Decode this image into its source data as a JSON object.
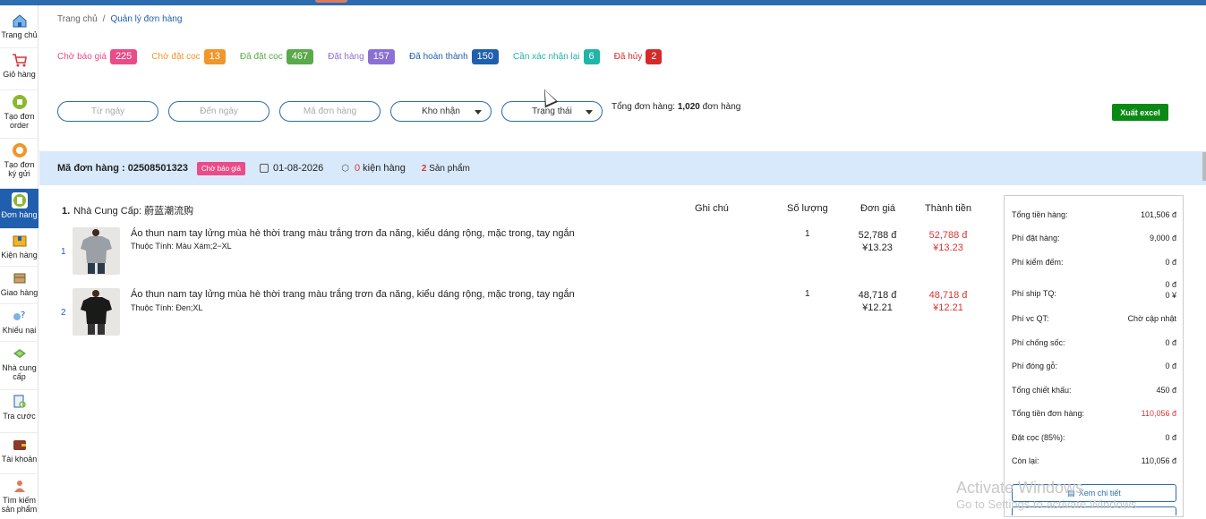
{
  "breadcrumb": {
    "home": "Trang chủ",
    "sep": "/",
    "current": "Quản lý đơn hàng"
  },
  "sidebar": {
    "items": [
      {
        "label": "Trang chủ",
        "icon": "home-icon"
      },
      {
        "label": "Giỏ hàng",
        "icon": "cart-icon"
      },
      {
        "label": "Tạo đơn order",
        "icon": "create-order-icon"
      },
      {
        "label": "Tạo đơn ký gửi",
        "icon": "consign-icon"
      },
      {
        "label": "Đơn hàng",
        "icon": "orders-icon"
      },
      {
        "label": "Kiện hàng",
        "icon": "package-icon"
      },
      {
        "label": "Giao hàng",
        "icon": "delivery-icon"
      },
      {
        "label": "Khiếu nại",
        "icon": "complaint-icon"
      },
      {
        "label": "Nhà cung cấp",
        "icon": "supplier-icon"
      },
      {
        "label": "Tra cước",
        "icon": "fee-lookup-icon"
      },
      {
        "label": "Tài khoản",
        "icon": "wallet-icon"
      },
      {
        "label": "Tìm kiếm sản phẩm",
        "icon": "product-search-icon"
      }
    ]
  },
  "statuses": [
    {
      "label": "Chờ báo giá",
      "count": "225",
      "color": "#e94c88",
      "text": "#e94c88"
    },
    {
      "label": "Chờ đặt cọc",
      "count": "13",
      "color": "#f0962a",
      "text": "#f0962a"
    },
    {
      "label": "Đã đặt cọc",
      "count": "467",
      "color": "#5aa94a",
      "text": "#5aa94a"
    },
    {
      "label": "Đặt hàng",
      "count": "157",
      "color": "#8a6fd4",
      "text": "#8a6fd4"
    },
    {
      "label": "Đã hoàn thành",
      "count": "150",
      "color": "#1f5fae",
      "text": "#1f5fae"
    },
    {
      "label": "Cần xác nhận lại",
      "count": "6",
      "color": "#1fb5a8",
      "text": "#1fb5a8"
    },
    {
      "label": "Đã hủy",
      "count": "2",
      "color": "#d62a2a",
      "text": "#d62a2a"
    }
  ],
  "filters": {
    "from_date": "Từ ngày",
    "to_date": "Đến ngày",
    "order_code": "Mã đơn hàng",
    "warehouse": "Kho nhận",
    "status": "Trạng thái"
  },
  "total_orders": {
    "prefix": "Tổng đơn hàng: ",
    "count": "1,020",
    "suffix": " đơn hàng"
  },
  "export_label": "Xuất excel",
  "order": {
    "id_label": "Mã đơn hàng : 02508501323",
    "status_tag": "Chờ báo giá",
    "date": "01-08-2026",
    "packages_count": "0",
    "packages_label": " kiện hàng",
    "products_count": "2",
    "products_label": " Sản phẩm",
    "supplier_prefix": "1.",
    "supplier_label": "Nhà Cung Cấp: 蔚蓝潮流购",
    "columns": {
      "note": "Ghi chú",
      "qty": "Số lượng",
      "unit_price": "Đơn giá",
      "amount": "Thành tiền"
    },
    "items": [
      {
        "idx": "1",
        "name": "Áo thun nam tay lửng mùa hè thời trang màu trắng trơn đa năng, kiểu dáng rộng, mặc trong, tay ngắn",
        "attr": "Thuộc Tính: Màu Xám;2−XL",
        "qty": "1",
        "price_vnd": "52,788 đ",
        "price_cny": "¥13.23",
        "total_vnd": "52,788 đ",
        "total_cny": "¥13.23",
        "shirt_color": "#9aa0a6"
      },
      {
        "idx": "2",
        "name": "Áo thun nam tay lửng mùa hè thời trang màu trắng trơn đa năng, kiểu dáng rộng, mặc trong, tay ngắn",
        "attr": "Thuộc Tính: Đen;XL",
        "qty": "1",
        "price_vnd": "48,718 đ",
        "price_cny": "¥12.21",
        "total_vnd": "48,718 đ",
        "total_cny": "¥12.21",
        "shirt_color": "#1a1a1a"
      }
    ]
  },
  "summary": {
    "rows": [
      {
        "label": "Tổng tiền hàng:",
        "value": "101,506 đ"
      },
      {
        "label": "Phí đặt hàng:",
        "value": "9,000 đ"
      },
      {
        "label": "Phí kiểm đếm:",
        "value": "0 đ"
      },
      {
        "label": "Phí ship TQ:",
        "value": "0 đ",
        "value2": "0 ¥"
      },
      {
        "label": "Phí vc QT:",
        "value": "Chờ cập nhật"
      },
      {
        "label": "Phí chống sốc:",
        "value": "0 đ"
      },
      {
        "label": "Phí đóng gỗ:",
        "value": "0 đ"
      },
      {
        "label": "Tổng chiết khấu:",
        "value": "450 đ"
      },
      {
        "label": "Tổng tiền đơn hàng:",
        "value": "110,056 đ",
        "red": true
      },
      {
        "label": "Đặt cọc (85%):",
        "value": "0 đ"
      },
      {
        "label": "Còn lại:",
        "value": "110,056 đ"
      }
    ],
    "detail_button": "Xem chi tiết"
  },
  "watermark": {
    "title": "Activate Windows",
    "sub": "Go to Settings to activate Windows."
  }
}
